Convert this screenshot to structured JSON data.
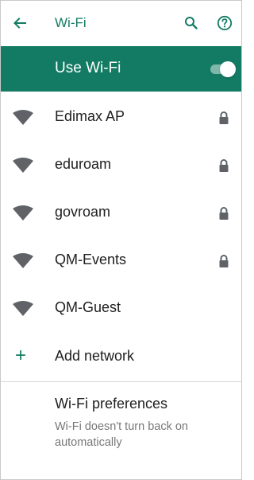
{
  "app_bar": {
    "back_icon": "arrow-left-icon",
    "title": "Wi-Fi",
    "search_icon": "search-icon",
    "help_icon": "help-circle-icon"
  },
  "master_switch": {
    "label": "Use Wi-Fi",
    "state": "on"
  },
  "networks": [
    {
      "name": "Edimax AP",
      "secured": true
    },
    {
      "name": "eduroam",
      "secured": true
    },
    {
      "name": "govroam",
      "secured": true
    },
    {
      "name": "QM-Events",
      "secured": true
    },
    {
      "name": "QM-Guest",
      "secured": false
    }
  ],
  "add_network": {
    "icon": "plus-icon",
    "label": "Add network"
  },
  "preferences": {
    "title": "Wi-Fi preferences",
    "subtitle": "Wi-Fi doesn't turn back on automatically"
  },
  "colors": {
    "accent": "#137b63",
    "text_primary": "#202020",
    "text_secondary": "#777777",
    "icon_gray": "#5f6368"
  }
}
